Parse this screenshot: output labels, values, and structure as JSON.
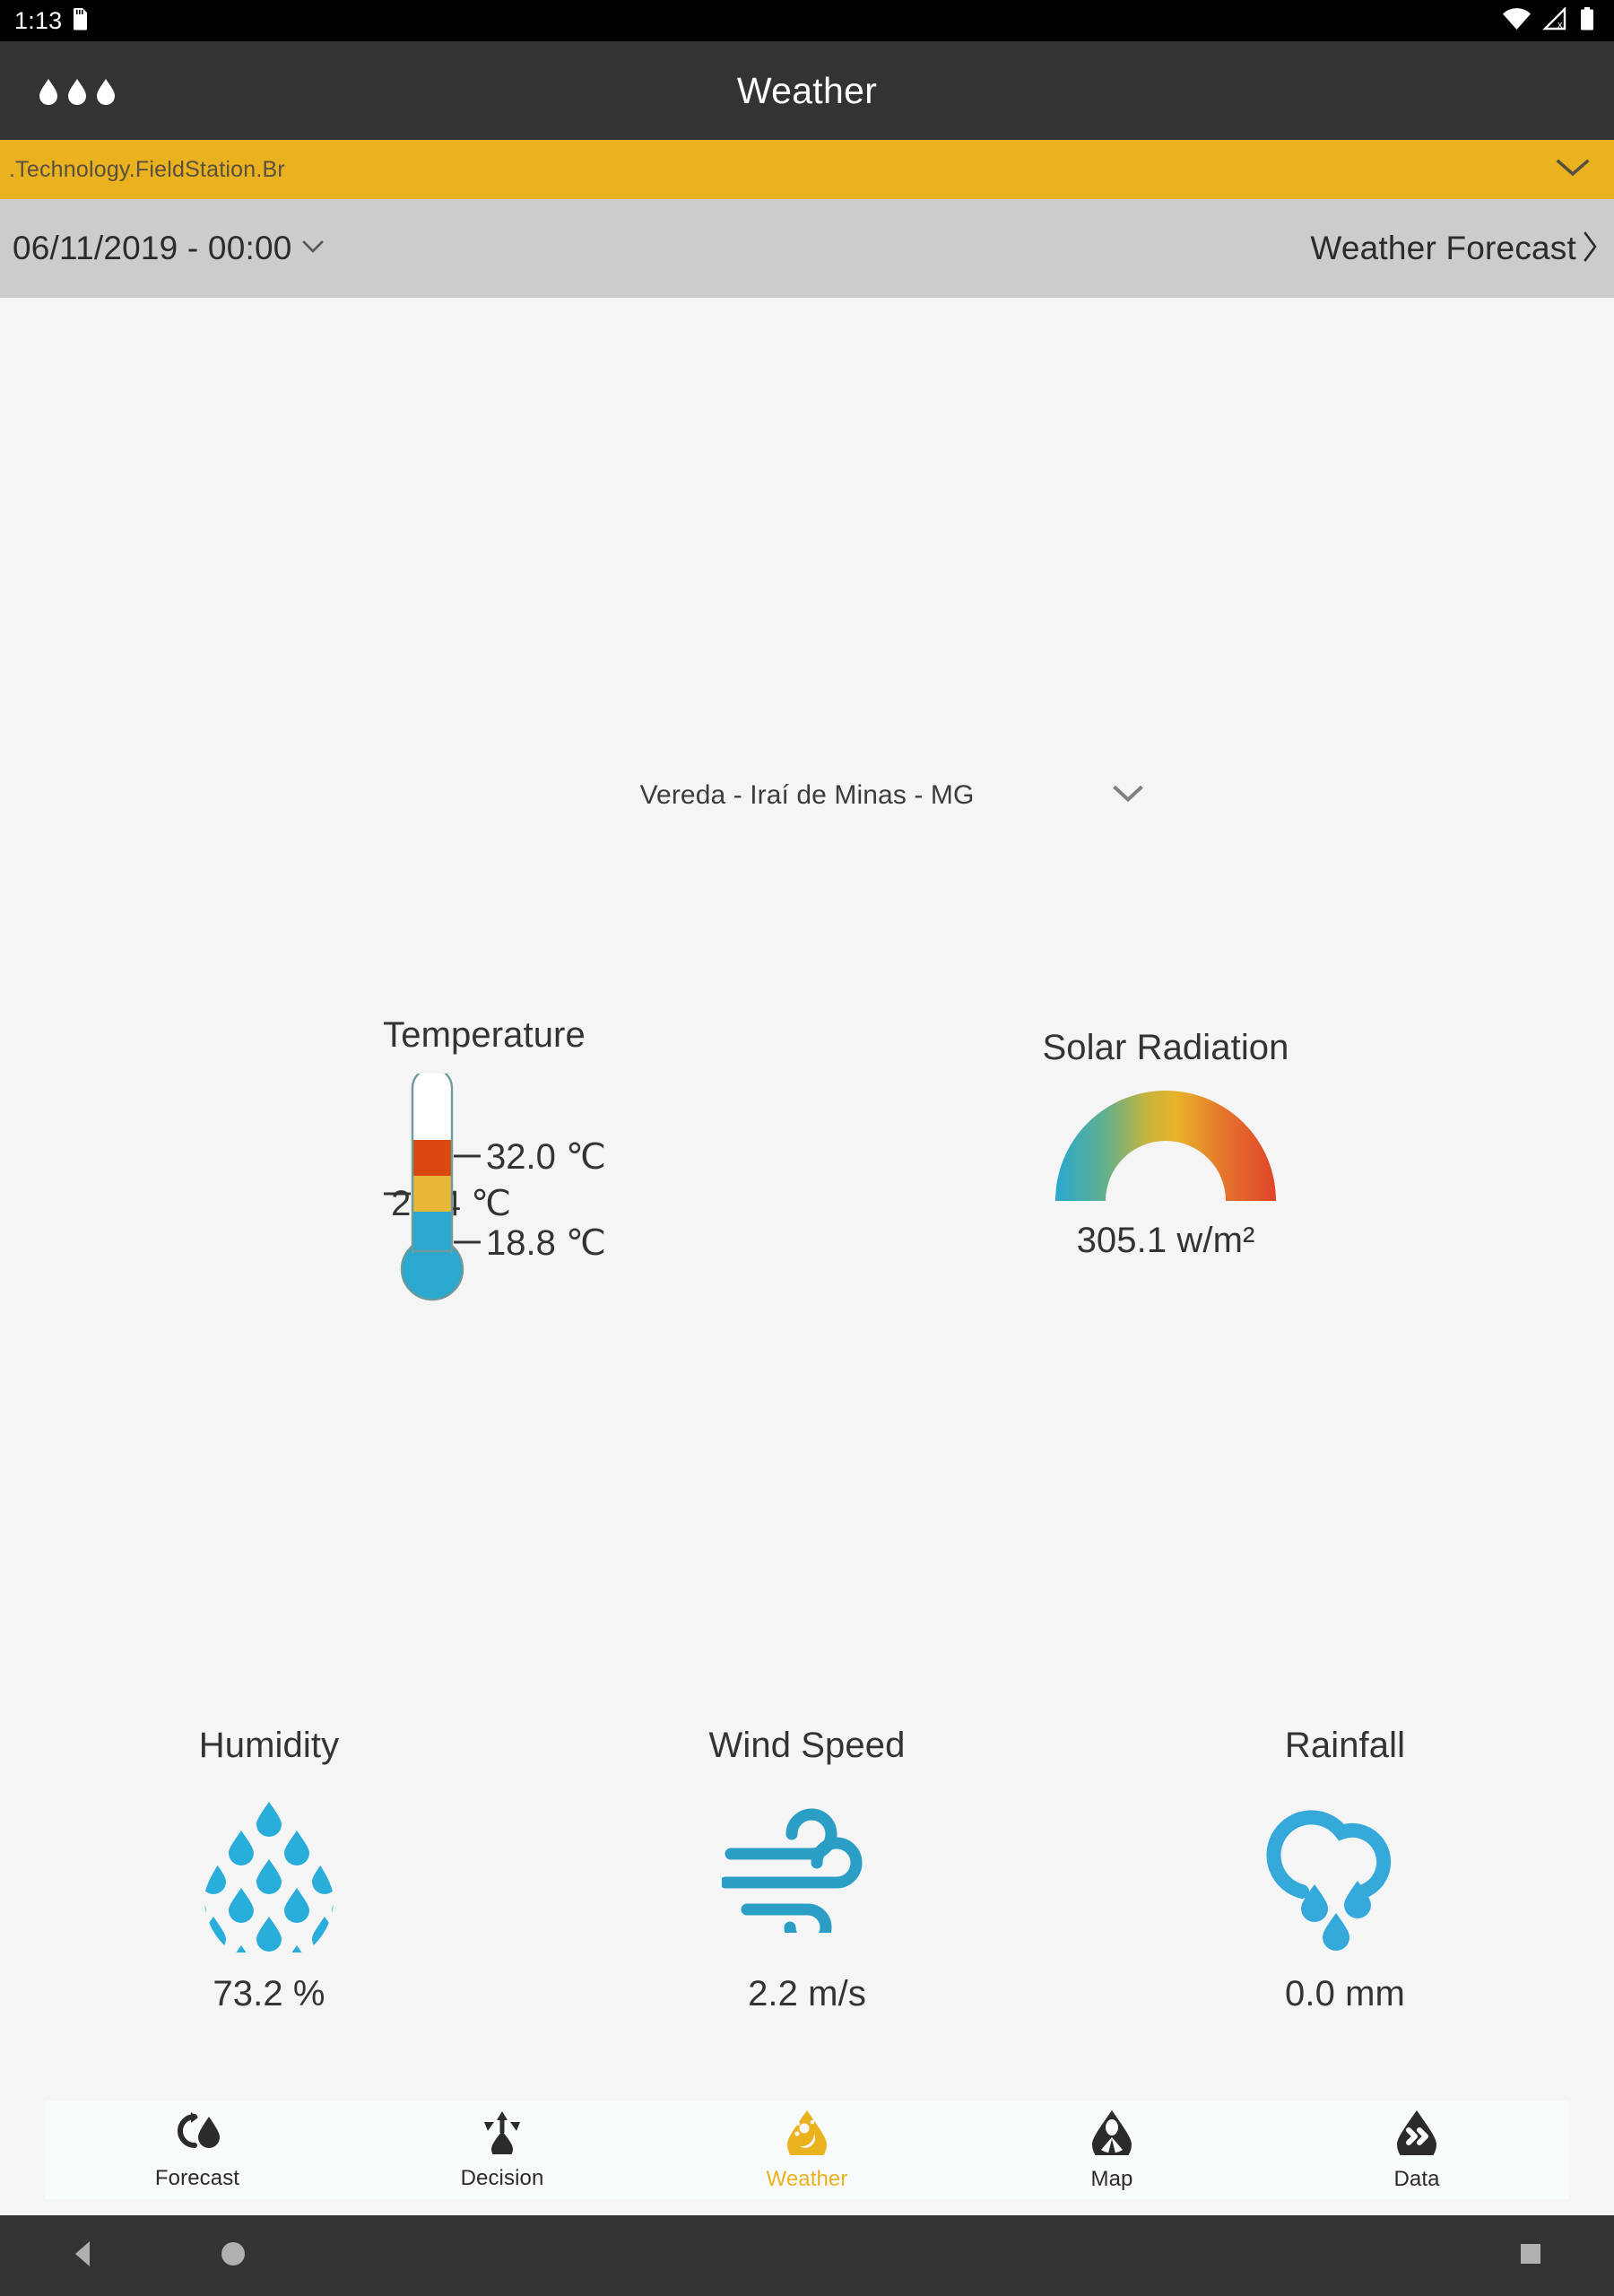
{
  "status_bar": {
    "time": "1:13",
    "icons": [
      "sdcard-icon",
      "wifi-icon",
      "cellular-no-signal-icon",
      "battery-icon"
    ]
  },
  "toolbar": {
    "title": "Weather",
    "overflow_icon": "overflow-menu-droplets-icon"
  },
  "account_bar": {
    "label": ".Technology.FieldStation.Br",
    "chevron_icon": "chevron-down-icon",
    "color": "#ebb21f"
  },
  "date_bar": {
    "datetime": "06/11/2019 - 00:00",
    "dropdown_icon": "chevron-down-icon",
    "forecast_link": "Weather Forecast",
    "forecast_icon": "chevron-right-icon",
    "background": "#cccccc"
  },
  "location": {
    "name": "Vereda - Iraí de Minas - MG",
    "chevron_icon": "chevron-down-icon"
  },
  "widgets": {
    "temperature": {
      "title": "Temperature",
      "current": "24.4 ℃",
      "max": "32.0 ℃",
      "min": "18.8 ℃",
      "icon": "thermometer-icon",
      "colors": {
        "hot": "#d9480f",
        "warm": "#e8b73a",
        "cold": "#2aa8cf"
      }
    },
    "solar_radiation": {
      "title": "Solar Radiation",
      "value": "305.1 w/m²",
      "icon": "gauge-arc-icon",
      "gradient_from": "#2aa8cf",
      "gradient_mid": "#e8b22a",
      "gradient_to": "#e0452a"
    },
    "humidity": {
      "title": "Humidity",
      "value": "73.2 %",
      "icon": "humidity-droplets-icon",
      "color": "#29aedb"
    },
    "wind_speed": {
      "title": "Wind Speed",
      "value": "2.2 m/s",
      "icon": "wind-icon",
      "color": "#2a9ec4"
    },
    "rainfall": {
      "title": "Rainfall",
      "value": "0.0 mm",
      "icon": "rain-cloud-icon",
      "color": "#35aada"
    }
  },
  "tabs": [
    {
      "label": "Forecast",
      "icon": "forecast-refresh-droplet-icon",
      "active": false
    },
    {
      "label": "Decision",
      "icon": "decision-arrows-droplet-icon",
      "active": false
    },
    {
      "label": "Weather",
      "icon": "weather-sun-droplet-icon",
      "active": true
    },
    {
      "label": "Map",
      "icon": "map-pin-droplet-icon",
      "active": false
    },
    {
      "label": "Data",
      "icon": "data-chevrons-droplet-icon",
      "active": false
    }
  ],
  "active_tab_color": "#ebb21f",
  "nav_bar": {
    "back_icon": "back-triangle-icon",
    "home_icon": "home-circle-icon",
    "recent_icon": "recents-square-icon"
  }
}
